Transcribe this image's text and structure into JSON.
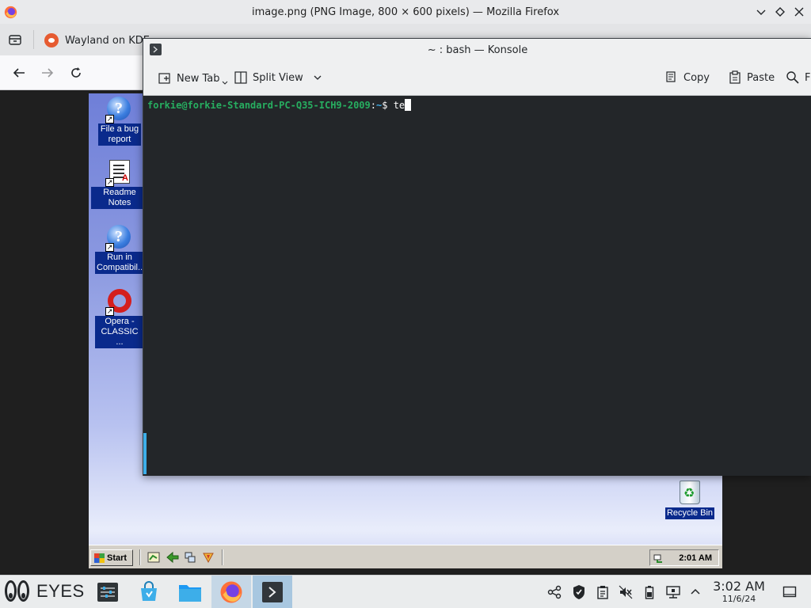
{
  "firefox": {
    "window_title": "image.png (PNG Image, 800 × 600 pixels) — Mozilla Firefox",
    "tabs": [
      {
        "label": "Wayland on KDE"
      },
      {
        "label": ""
      }
    ]
  },
  "desktop_image": {
    "icons": [
      {
        "label": "File a bug report",
        "icon": "help-icon"
      },
      {
        "label": "Readme Notes",
        "icon": "notepad-icon"
      },
      {
        "label": "Run in Compatibil...",
        "icon": "help-icon"
      },
      {
        "label": "Opera -CLASSIC ...",
        "icon": "opera-icon"
      },
      {
        "label": "Recycle Bin",
        "icon": "recycle-bin-icon"
      }
    ],
    "taskbar": {
      "start_label": "Start",
      "clock": "2:01 AM"
    }
  },
  "konsole": {
    "title": "~ : bash — Konsole",
    "toolbar": {
      "new_tab": "New Tab",
      "split_view": "Split View",
      "copy": "Copy",
      "paste": "Paste",
      "find": "F"
    },
    "terminal": {
      "user_host": "forkie@forkie-Standard-PC-Q35-ICH9-2009",
      "sep": ":",
      "path": "~",
      "dollar": "$ ",
      "command": "te"
    }
  },
  "panel": {
    "eyes_label": "EYES",
    "clock_time": "3:02 AM",
    "clock_date": "11/6/24"
  }
}
